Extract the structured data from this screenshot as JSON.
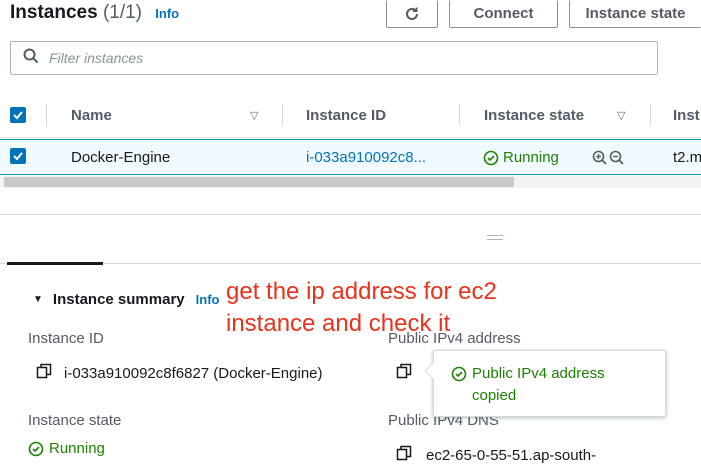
{
  "header": {
    "title": "Instances",
    "count": "(1/1)",
    "info_label": "Info",
    "refresh_icon": "refresh-icon",
    "connect_label": "Connect",
    "instance_state_label": "Instance state"
  },
  "search": {
    "placeholder": "Filter instances",
    "icon": "search-icon"
  },
  "table": {
    "columns": [
      "Name",
      "Instance ID",
      "Instance state",
      "Inst"
    ],
    "rows": [
      {
        "name": "Docker-Engine",
        "instance_id": "i-033a910092c8...",
        "state": "Running",
        "type": "t2.m"
      }
    ]
  },
  "details": {
    "summary_label": "Instance summary",
    "info_label": "Info",
    "instance_id_label": "Instance ID",
    "instance_id_value": "i-033a910092c8f6827 (Docker-Engine)",
    "public_ipv4_label": "Public IPv4 address",
    "instance_state_label": "Instance state",
    "instance_state_value": "Running",
    "public_dns_label": "Public IPv4 DNS",
    "public_dns_value": "ec2-65-0-55-51.ap-south-"
  },
  "popover": {
    "message": "Public IPv4 address copied"
  },
  "annotation": {
    "line1": "get the ip address for ec2",
    "line2": "instance and check it"
  },
  "colors": {
    "accent": "#0073bb",
    "success": "#1d8102",
    "annotation": "#e8331c",
    "selected_row": "#f1faff"
  }
}
